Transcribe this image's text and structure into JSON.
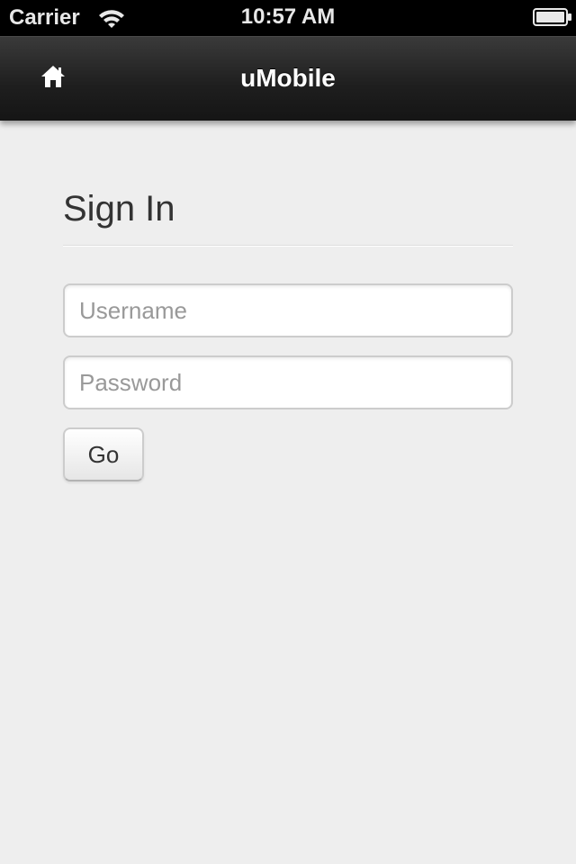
{
  "status_bar": {
    "carrier": "Carrier",
    "time": "10:57 AM",
    "wifi_icon": "wifi-icon",
    "battery_icon": "battery-icon"
  },
  "header": {
    "title": "uMobile",
    "home_icon": "home-icon",
    "background_color": "#1e1e1e"
  },
  "main": {
    "title": "Sign In",
    "username": {
      "value": "",
      "placeholder": "Username"
    },
    "password": {
      "value": "",
      "placeholder": "Password"
    },
    "submit_label": "Go"
  },
  "colors": {
    "page_background": "#eeeeee",
    "status_bar": "#000000",
    "text": "#333333",
    "placeholder": "#999999"
  }
}
